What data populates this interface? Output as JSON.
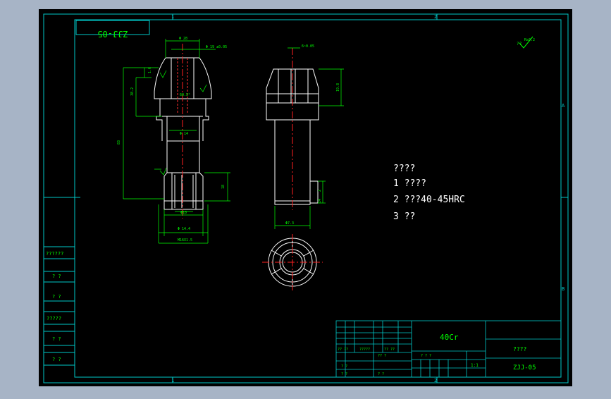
{
  "colors": {
    "background": "#000000",
    "frame": "#00c8c8",
    "outline": "#ffffff",
    "dimension": "#00ff00",
    "centerline": "#ff2020",
    "hidden": "#ff3030",
    "text": "#ffffff",
    "gray_surround": "#a7b4c6"
  },
  "drawing": {
    "code_box": "ZJJ-05",
    "surface_mark": "Ra3.2",
    "notes": {
      "heading": "????",
      "line1": "1 ????",
      "line2": "2 ???40-45HRC",
      "line3": "3 ??"
    },
    "zone_labels": {
      "top1": "1",
      "top2": "2",
      "right1": "A",
      "right2": "B",
      "bottom1": "1",
      "bottom2": "2"
    },
    "side_table": [
      "??????",
      "? ?",
      "? ?",
      "?????",
      "? ?",
      "? ?"
    ],
    "title_block": {
      "material": "40Cr",
      "name": "????",
      "code": "ZJJ-05",
      "scale": "1:1",
      "cells": {
        "a": "?? ??",
        "b": "?????",
        "c": "?? ??",
        "d": "? ? ?",
        "e": "? ?",
        "f": "? ?",
        "g": "?? ?",
        "h": "? ?"
      }
    },
    "dims": {
      "d28": "Φ 28",
      "d19": "Φ 19 ±0.05",
      "l6": "1.6",
      "l38": "38.2",
      "angle": "60.5°",
      "d14": "Φ 14",
      "l83": "83",
      "l18": "18",
      "d10": "Φ10",
      "d14b": "Φ 14.4",
      "m16": "M16X1.5",
      "width": "6~0.05",
      "l19": "19.8",
      "d17": "Φ7.3",
      "l2": "2",
      "l14": "14"
    }
  }
}
